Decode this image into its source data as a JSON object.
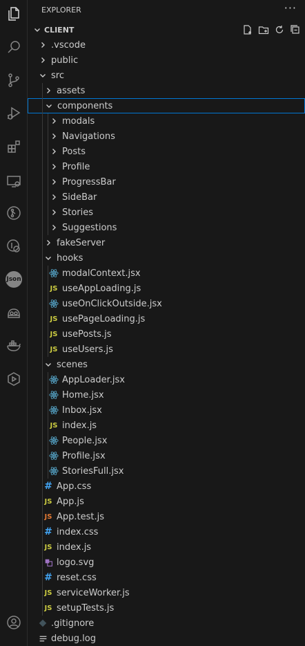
{
  "explorer": {
    "title": "EXPLORER",
    "more": "···",
    "root": "CLIENT"
  },
  "activity_bar": [
    "explorer-icon",
    "search-icon",
    "source-control-icon",
    "run-debug-icon",
    "extensions-icon",
    "remote-explorer-icon",
    "git-graph-icon",
    "github-icon",
    "json-icon",
    "copilot-icon",
    "docker-icon",
    "live-share-icon",
    "account-icon"
  ],
  "json_badge": "Json",
  "colors": {
    "react": "#519aba",
    "js": "#cbcb41",
    "css": "#42a5f5",
    "test": "#e37933",
    "svg": "#a074c4",
    "selection_border": "#0078d4"
  },
  "tree": [
    {
      "name": ".vscode",
      "type": "folder",
      "depth": 1,
      "open": false
    },
    {
      "name": "public",
      "type": "folder",
      "depth": 1,
      "open": false
    },
    {
      "name": "src",
      "type": "folder",
      "depth": 1,
      "open": true
    },
    {
      "name": "assets",
      "type": "folder",
      "depth": 2,
      "open": false
    },
    {
      "name": "components",
      "type": "folder",
      "depth": 2,
      "open": true,
      "selected": true
    },
    {
      "name": "modals",
      "type": "folder",
      "depth": 3,
      "open": false
    },
    {
      "name": "Navigations",
      "type": "folder",
      "depth": 3,
      "open": false
    },
    {
      "name": "Posts",
      "type": "folder",
      "depth": 3,
      "open": false
    },
    {
      "name": "Profile",
      "type": "folder",
      "depth": 3,
      "open": false
    },
    {
      "name": "ProgressBar",
      "type": "folder",
      "depth": 3,
      "open": false
    },
    {
      "name": "SideBar",
      "type": "folder",
      "depth": 3,
      "open": false
    },
    {
      "name": "Stories",
      "type": "folder",
      "depth": 3,
      "open": false
    },
    {
      "name": "Suggestions",
      "type": "folder",
      "depth": 3,
      "open": false
    },
    {
      "name": "fakeServer",
      "type": "folder",
      "depth": 2,
      "open": false
    },
    {
      "name": "hooks",
      "type": "folder",
      "depth": 2,
      "open": true
    },
    {
      "name": "modalContext.jsx",
      "type": "jsx",
      "depth": 3
    },
    {
      "name": "useAppLoading.js",
      "type": "js",
      "depth": 3
    },
    {
      "name": "useOnClickOutside.jsx",
      "type": "jsx",
      "depth": 3
    },
    {
      "name": "usePageLoading.js",
      "type": "js",
      "depth": 3
    },
    {
      "name": "usePosts.js",
      "type": "js",
      "depth": 3
    },
    {
      "name": "useUsers.js",
      "type": "js",
      "depth": 3
    },
    {
      "name": "scenes",
      "type": "folder",
      "depth": 2,
      "open": true
    },
    {
      "name": "AppLoader.jsx",
      "type": "jsx",
      "depth": 3
    },
    {
      "name": "Home.jsx",
      "type": "jsx",
      "depth": 3
    },
    {
      "name": "Inbox.jsx",
      "type": "jsx",
      "depth": 3
    },
    {
      "name": "index.js",
      "type": "js",
      "depth": 3
    },
    {
      "name": "People.jsx",
      "type": "jsx",
      "depth": 3
    },
    {
      "name": "Profile.jsx",
      "type": "jsx",
      "depth": 3
    },
    {
      "name": "StoriesFull.jsx",
      "type": "jsx",
      "depth": 3
    },
    {
      "name": "App.css",
      "type": "css",
      "depth": 2
    },
    {
      "name": "App.js",
      "type": "js",
      "depth": 2
    },
    {
      "name": "App.test.js",
      "type": "test",
      "depth": 2
    },
    {
      "name": "index.css",
      "type": "css",
      "depth": 2
    },
    {
      "name": "index.js",
      "type": "js",
      "depth": 2
    },
    {
      "name": "logo.svg",
      "type": "svg",
      "depth": 2
    },
    {
      "name": "reset.css",
      "type": "css",
      "depth": 2
    },
    {
      "name": "serviceWorker.js",
      "type": "js",
      "depth": 2
    },
    {
      "name": "setupTests.js",
      "type": "js",
      "depth": 2
    },
    {
      "name": ".gitignore",
      "type": "git",
      "depth": 1
    },
    {
      "name": "debug.log",
      "type": "log",
      "depth": 1
    }
  ]
}
